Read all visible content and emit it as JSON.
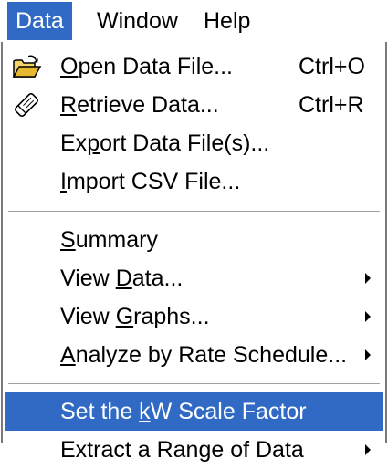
{
  "menubar": {
    "items": [
      {
        "label": "Data",
        "active": true
      },
      {
        "label": "Window",
        "active": false
      },
      {
        "label": "Help",
        "active": false
      }
    ]
  },
  "menu": {
    "items": [
      {
        "pre": "",
        "key": "O",
        "post": "pen Data File...",
        "shortcut": "Ctrl+O",
        "icon": "open-folder-icon"
      },
      {
        "pre": "",
        "key": "R",
        "post": "etrieve Data...",
        "shortcut": "Ctrl+R",
        "icon": "retrieve-data-icon"
      },
      {
        "pre": "Ex",
        "key": "p",
        "post": "ort Data File(s)...",
        "shortcut": ""
      },
      {
        "pre": "",
        "key": "I",
        "post": "mport CSV File...",
        "shortcut": ""
      },
      {
        "pre": "",
        "key": "S",
        "post": "ummary",
        "shortcut": ""
      },
      {
        "pre": "View ",
        "key": "D",
        "post": "ata...",
        "submenu": true
      },
      {
        "pre": "View ",
        "key": "G",
        "post": "raphs...",
        "submenu": true
      },
      {
        "pre": "",
        "key": "A",
        "post": "nalyze by Rate Schedule...",
        "submenu": true
      },
      {
        "pre": "Set the ",
        "key": "k",
        "post": "W Scale Factor",
        "highlighted": true
      },
      {
        "pre": "Extract a Range of Data",
        "key": "",
        "post": "",
        "submenu": true
      }
    ]
  },
  "colors": {
    "highlight": "#316ac5",
    "highlight_text": "#ffffff",
    "border": "#7a7a7a"
  }
}
